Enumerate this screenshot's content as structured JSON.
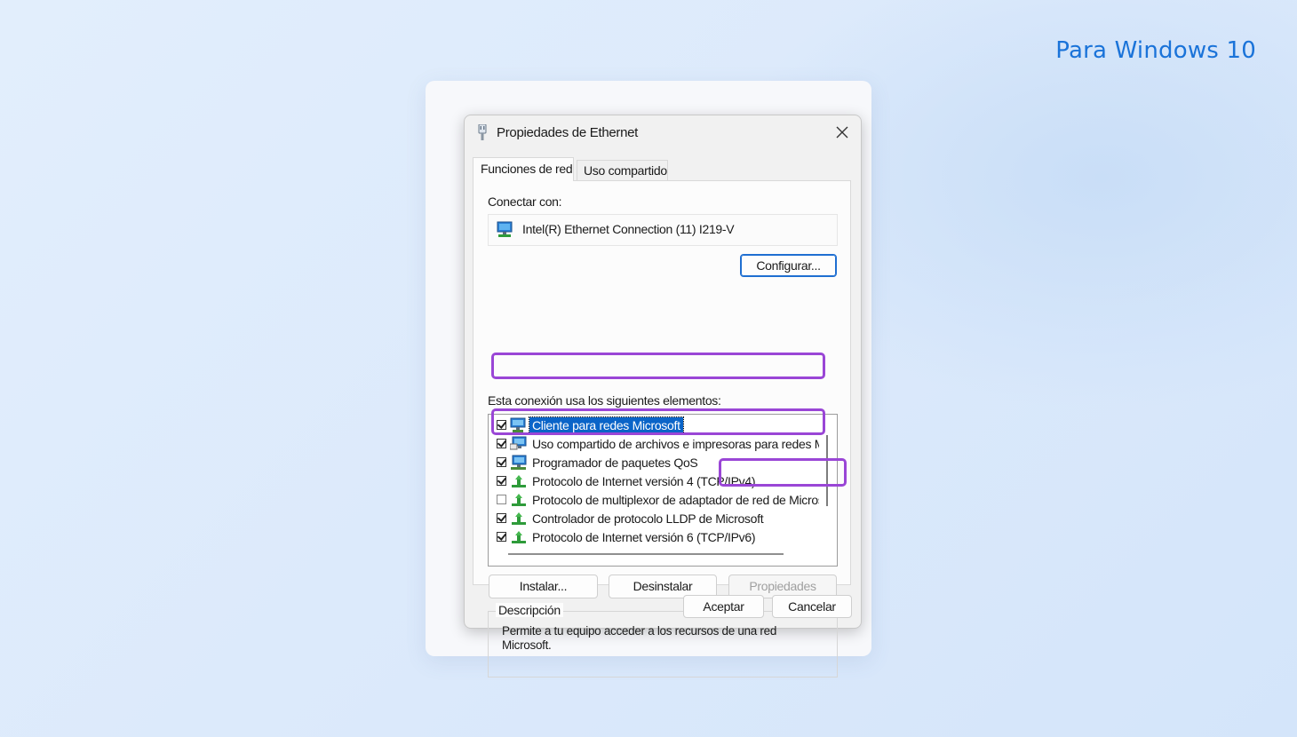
{
  "promo": {
    "label": "Para Windows 10"
  },
  "dialog": {
    "title": "Propiedades de Ethernet",
    "tabs": [
      {
        "label": "Funciones de red",
        "active": true
      },
      {
        "label": "Uso compartido",
        "active": false
      }
    ],
    "connect_with_label": "Conectar con:",
    "adapter_name": "Intel(R) Ethernet Connection (11) I219-V",
    "configure_button": "Configurar...",
    "items_label": "Esta conexión usa los siguientes elementos:",
    "items": [
      {
        "label": "Cliente para redes Microsoft",
        "checked": true,
        "selected": true,
        "icon": "network-client-icon"
      },
      {
        "label": "Uso compartido de archivos e impresoras para redes Microsoft",
        "checked": true,
        "selected": false,
        "icon": "file-sharing-icon"
      },
      {
        "label": "Programador de paquetes QoS",
        "checked": true,
        "selected": false,
        "icon": "qos-scheduler-icon"
      },
      {
        "label": "Protocolo de Internet versión 4 (TCP/IPv4)",
        "checked": true,
        "selected": false,
        "icon": "protocol-icon",
        "highlighted": true
      },
      {
        "label": "Protocolo de multiplexor de adaptador de red de Microsoft",
        "checked": false,
        "selected": false,
        "icon": "protocol-icon"
      },
      {
        "label": "Controlador de protocolo LLDP de Microsoft",
        "checked": true,
        "selected": false,
        "icon": "protocol-icon"
      },
      {
        "label": "Protocolo de Internet versión 6 (TCP/IPv6)",
        "checked": true,
        "selected": false,
        "icon": "protocol-icon",
        "highlighted": true
      }
    ],
    "install_button": "Instalar...",
    "uninstall_button": "Desinstalar",
    "properties_button": "Propiedades",
    "description_legend": "Descripción",
    "description_text": "Permite a tu equipo acceder a los recursos de una red Microsoft.",
    "ok_button": "Aceptar",
    "cancel_button": "Cancelar"
  },
  "colors": {
    "highlight": "#9a46d6",
    "selection": "#0a64c8",
    "primary_border": "#1f6fd1",
    "promo_text": "#1a73d9"
  }
}
